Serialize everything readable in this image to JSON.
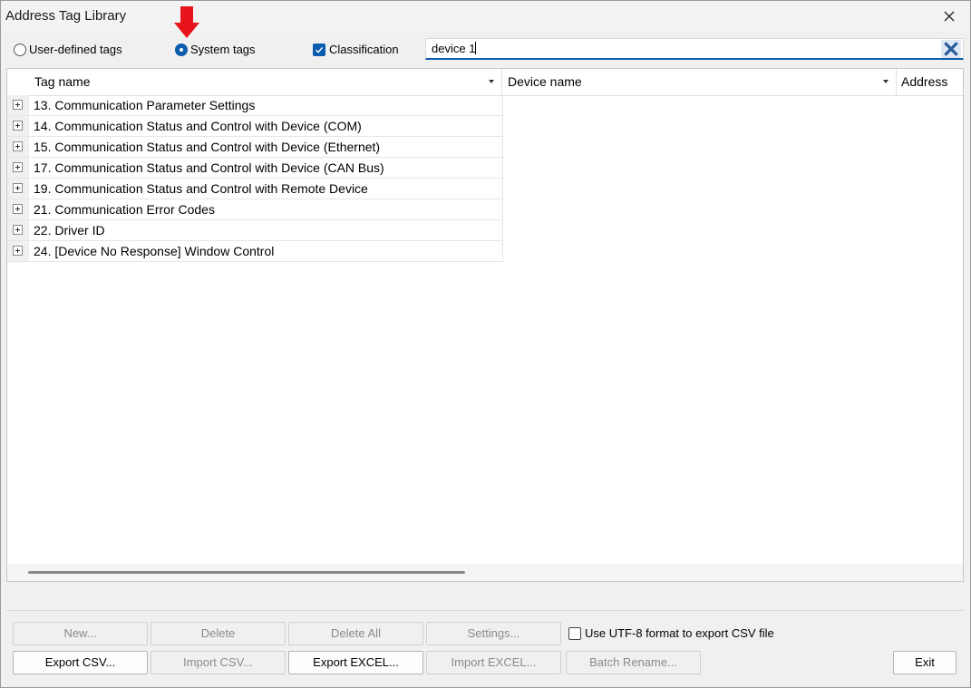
{
  "window": {
    "title": "Address Tag Library"
  },
  "toolbar": {
    "user_defined_label": "User-defined tags",
    "user_defined_checked": false,
    "system_tags_label": "System tags",
    "system_tags_checked": true,
    "classification_label": "Classification",
    "classification_checked": true,
    "search_value": "device 1"
  },
  "table": {
    "columns": [
      "Tag name",
      "Device name",
      "Address"
    ],
    "rows": [
      "13. Communication Parameter Settings",
      "14. Communication Status and Control with Device (COM)",
      "15. Communication Status and Control with Device (Ethernet)",
      "17. Communication Status and Control with Device (CAN Bus)",
      "19. Communication Status and Control with Remote Device",
      "21. Communication Error Codes",
      "22. Driver ID",
      "24. [Device No Response] Window Control"
    ]
  },
  "buttons": {
    "new": "New...",
    "delete": "Delete",
    "delete_all": "Delete All",
    "settings": "Settings...",
    "export_csv": "Export CSV...",
    "import_csv": "Import CSV...",
    "export_excel": "Export EXCEL...",
    "import_excel": "Import EXCEL...",
    "batch_rename": "Batch Rename...",
    "exit": "Exit"
  },
  "utf8_option": {
    "label": "Use UTF-8 format to export CSV file",
    "checked": false
  },
  "colors": {
    "accent": "#0b5cad",
    "annotation_arrow": "#e8141c"
  }
}
